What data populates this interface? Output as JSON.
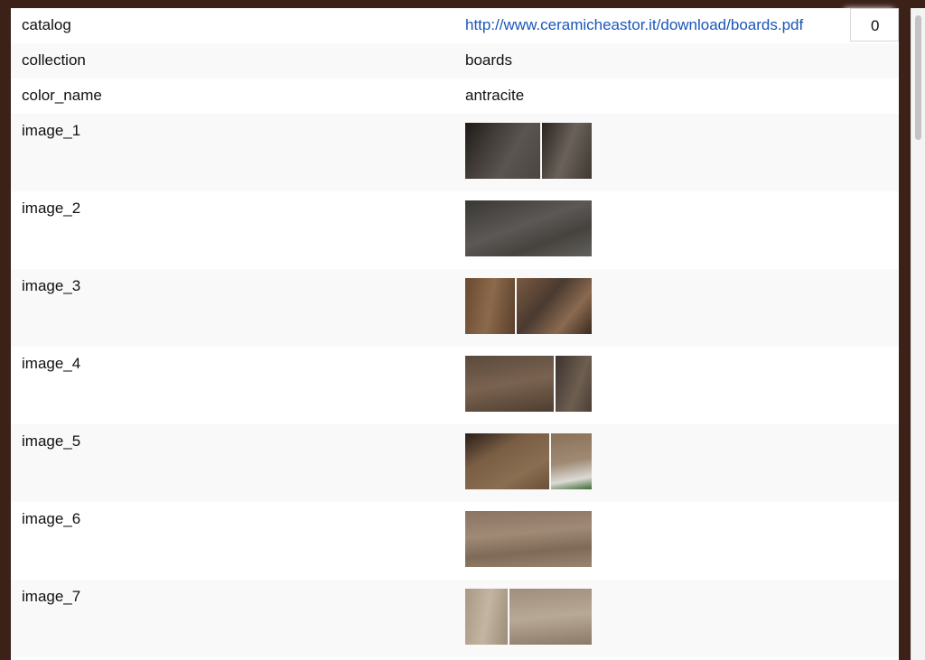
{
  "rows": [
    {
      "key": "catalog",
      "value": "http://www.ceramicheastor.it/download/boards.pdf"
    },
    {
      "key": "collection",
      "value": "boards"
    },
    {
      "key": "color_name",
      "value": "antracite"
    },
    {
      "key": "image_1"
    },
    {
      "key": "image_2"
    },
    {
      "key": "image_3"
    },
    {
      "key": "image_4"
    },
    {
      "key": "image_5"
    },
    {
      "key": "image_6"
    },
    {
      "key": "image_7"
    }
  ],
  "badge": {
    "count": "0"
  }
}
